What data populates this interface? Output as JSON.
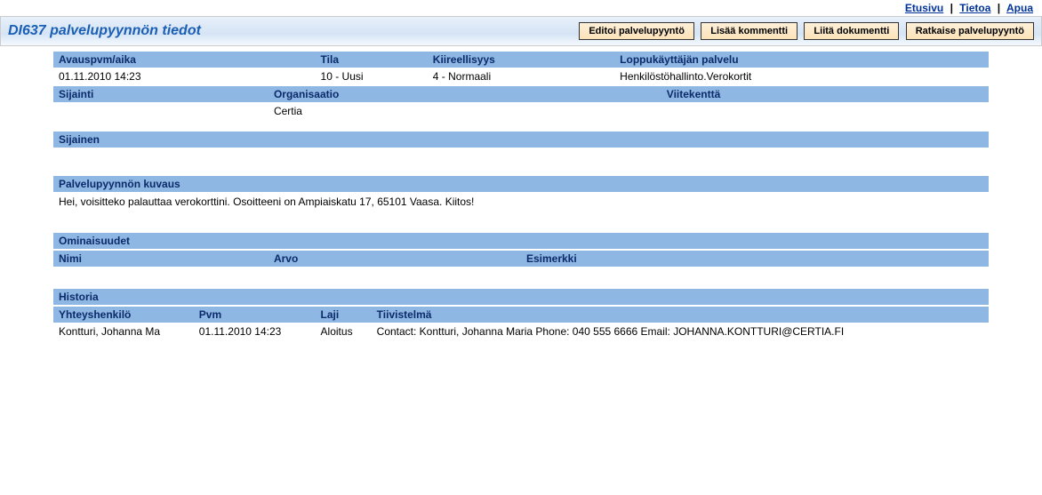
{
  "topnav": {
    "home": "Etusivu",
    "about": "Tietoa",
    "help": "Apua"
  },
  "header": {
    "title": "DI637 palvelupyynnön tiedot",
    "buttons": {
      "edit": "Editoi palvelupyyntö",
      "comment": "Lisää kommentti",
      "attach": "Liitä dokumentti",
      "resolve": "Ratkaise palvelupyyntö"
    }
  },
  "fields1": {
    "opened_label": "Avauspvm/aika",
    "opened_value": "01.11.2010 14:23",
    "status_label": "Tila",
    "status_value": "10 - Uusi",
    "urgency_label": "Kiireellisyys",
    "urgency_value": "4 - Normaali",
    "service_label": "Loppukäyttäjän palvelu",
    "service_value": "Henkilöstöhallinto.Verokortit"
  },
  "fields2": {
    "location_label": "Sijainti",
    "location_value": "",
    "org_label": "Organisaatio",
    "org_value": "Certia",
    "reffield_label": "Viitekenttä",
    "reffield_value": ""
  },
  "substitute": {
    "label": "Sijainen",
    "value": ""
  },
  "description": {
    "label": "Palvelupyynnön kuvaus",
    "value": "Hei, voisitteko palauttaa verokorttini. Osoitteeni on Ampiaiskatu 17, 65101 Vaasa. Kiitos!"
  },
  "attributes": {
    "label": "Ominaisuudet",
    "col_name": "Nimi",
    "col_value": "Arvo",
    "col_example": "Esimerkki"
  },
  "history": {
    "label": "Historia",
    "col_contact": "Yhteyshenkilö",
    "col_date": "Pvm",
    "col_type": "Laji",
    "col_summary": "Tiivistelmä",
    "rows": [
      {
        "contact": "Kontturi, Johanna Ma",
        "date": "01.11.2010 14:23",
        "type": "Aloitus",
        "summary": "Contact: Kontturi, Johanna Maria Phone: 040 555 6666 Email: JOHANNA.KONTTURI@CERTIA.FI"
      }
    ]
  }
}
